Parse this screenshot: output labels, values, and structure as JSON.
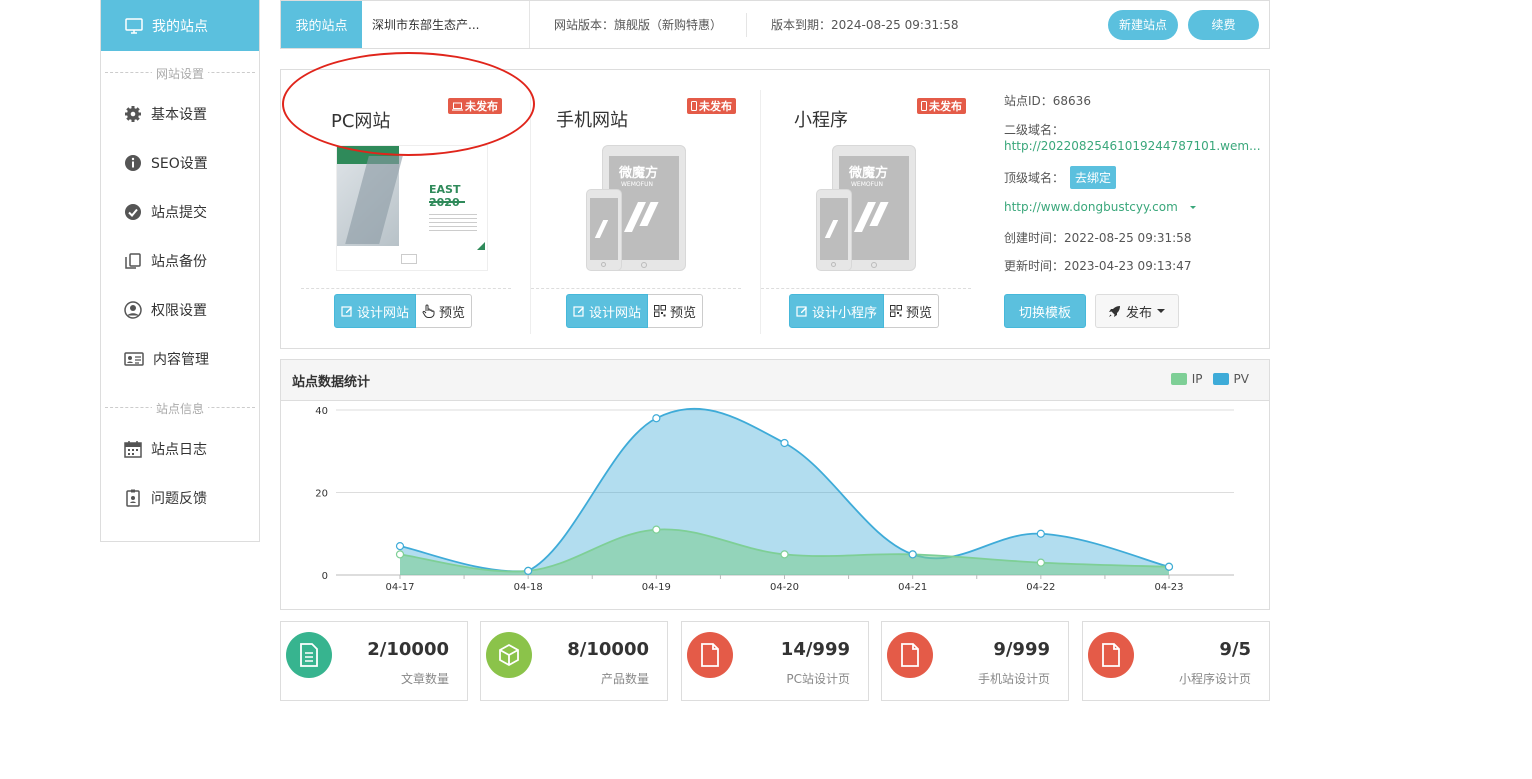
{
  "sidebar": {
    "active": "我的站点",
    "section1": "网站设置",
    "items1": [
      "基本设置",
      "SEO设置",
      "站点提交",
      "站点备份",
      "权限设置",
      "内容管理"
    ],
    "section2": "站点信息",
    "items2": [
      "站点日志",
      "问题反馈"
    ]
  },
  "topbar": {
    "tab": "我的站点",
    "site_name": "深圳市东部生态产...",
    "version": "网站版本：旗舰版（新购特惠）",
    "expiry": "版本到期：2024-08-25 09:31:58",
    "new_site": "新建站点",
    "renew": "续费"
  },
  "cards": [
    {
      "title": "PC网站",
      "badge": "未发布",
      "design": "设计网站",
      "preview": "预览"
    },
    {
      "title": "手机网站",
      "badge": "未发布",
      "design": "设计网站",
      "preview": "预览"
    },
    {
      "title": "小程序",
      "badge": "未发布",
      "design": "设计小程序",
      "preview": "预览"
    }
  ],
  "pc_thumb": {
    "headline": "EAST 2020"
  },
  "mock_brand": {
    "title": "微魔方",
    "sub": "WEMOFUN"
  },
  "site_info": {
    "site_id": "站点ID：68636",
    "sub_domain_label": "二级域名：",
    "sub_domain": "http://20220825461019244787101.wem...",
    "top_domain_label": "顶级域名：",
    "bind": "去绑定",
    "domain": "http://www.dongbustcyy.com",
    "created": "创建时间：2022-08-25 09:31:58",
    "updated": "更新时间：2023-04-23 09:13:47",
    "switch_template": "切换模板",
    "publish": "发布"
  },
  "chart_panel": {
    "title": "站点数据统计"
  },
  "chart_data": {
    "type": "area",
    "x": [
      "04-17",
      "04-18",
      "04-19",
      "04-20",
      "04-21",
      "04-22",
      "04-23"
    ],
    "ylim": [
      0,
      40
    ],
    "yticks": [
      0,
      20,
      40
    ],
    "series": [
      {
        "name": "IP",
        "values": [
          5,
          1,
          11,
          5,
          5,
          3,
          2
        ],
        "color": "#7ecf96"
      },
      {
        "name": "PV",
        "values": [
          7,
          1,
          38,
          32,
          5,
          10,
          2
        ],
        "color": "#3eabd8"
      }
    ],
    "legend": "top-right",
    "grid": true
  },
  "stats": [
    {
      "value": "2/10000",
      "label": "文章数量",
      "color": "#37b48f",
      "icon": "document-icon"
    },
    {
      "value": "8/10000",
      "label": "产品数量",
      "color": "#8bc34a",
      "icon": "box-icon"
    },
    {
      "value": "14/999",
      "label": "PC站设计页",
      "color": "#e45b48",
      "icon": "file-icon"
    },
    {
      "value": "9/999",
      "label": "手机站设计页",
      "color": "#e45b48",
      "icon": "file-icon"
    },
    {
      "value": "9/5",
      "label": "小程序设计页",
      "color": "#e45b48",
      "icon": "file-icon"
    }
  ]
}
